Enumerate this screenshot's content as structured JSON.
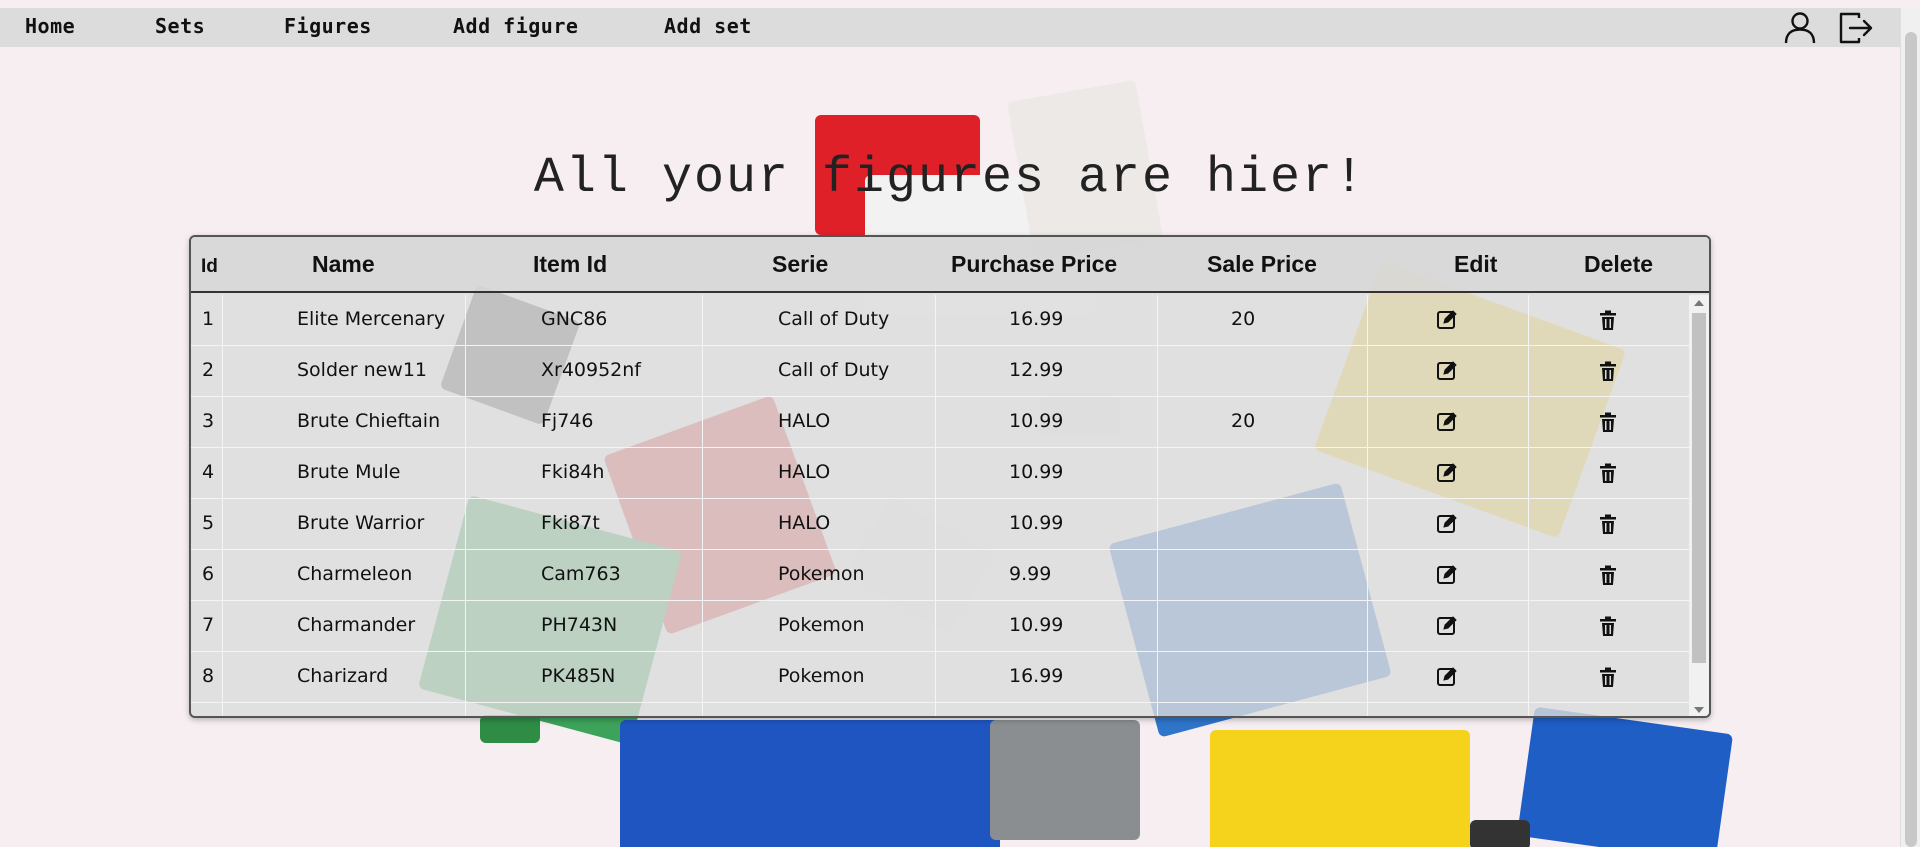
{
  "nav": {
    "items": [
      "Home",
      "Sets",
      "Figures",
      "Add figure",
      "Add set"
    ],
    "profile_icon": "user-icon",
    "logout_icon": "logout-icon"
  },
  "page": {
    "title": "All your figures are hier!"
  },
  "table": {
    "columns": [
      "Id",
      "Name",
      "Item Id",
      "Serie",
      "Purchase Price",
      "Sale Price",
      "Edit",
      "Delete"
    ],
    "rows": [
      {
        "id": "1",
        "name": "Elite Mercenary",
        "item_id": "GNC86",
        "serie": "Call of Duty",
        "purchase": "16.99",
        "sale": "20"
      },
      {
        "id": "2",
        "name": "Solder new11",
        "item_id": "Xr40952nf",
        "serie": "Call of Duty",
        "purchase": "12.99",
        "sale": ""
      },
      {
        "id": "3",
        "name": "Brute Chieftain",
        "item_id": "Fj746",
        "serie": "HALO",
        "purchase": "10.99",
        "sale": "20"
      },
      {
        "id": "4",
        "name": "Brute Mule",
        "item_id": "Fki84h",
        "serie": "HALO",
        "purchase": "10.99",
        "sale": ""
      },
      {
        "id": "5",
        "name": "Brute Warrior",
        "item_id": "Fki87t",
        "serie": "HALO",
        "purchase": "10.99",
        "sale": ""
      },
      {
        "id": "6",
        "name": "Charmeleon",
        "item_id": "Cam763",
        "serie": "Pokemon",
        "purchase": "9.99",
        "sale": ""
      },
      {
        "id": "7",
        "name": "Charmander",
        "item_id": "PH743N",
        "serie": "Pokemon",
        "purchase": "10.99",
        "sale": ""
      },
      {
        "id": "8",
        "name": "Charizard",
        "item_id": "PK485N",
        "serie": "Pokemon",
        "purchase": "16.99",
        "sale": ""
      }
    ],
    "edit_icon": "edit-icon",
    "delete_icon": "trash-icon"
  },
  "colors": {
    "navbar": "#dcdcdc",
    "background": "#f6eef1",
    "table_bg": "#dcdcdc"
  }
}
